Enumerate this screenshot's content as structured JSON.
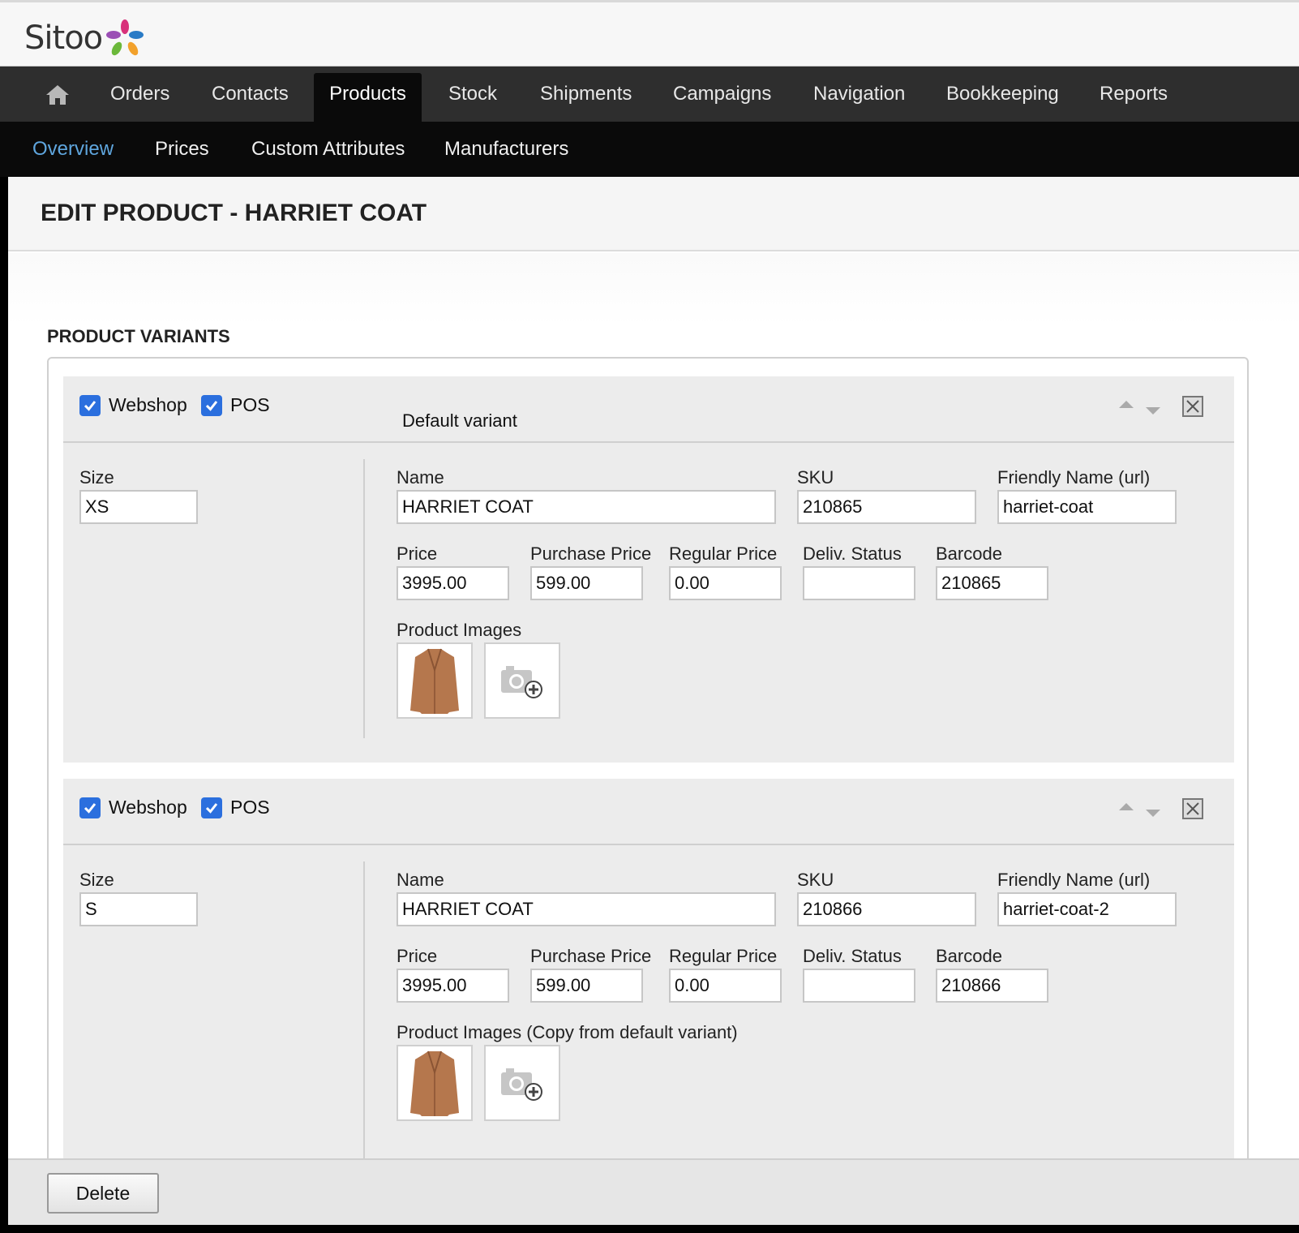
{
  "brand": {
    "logo_text": "Sitoo"
  },
  "main_nav": {
    "items": [
      "Orders",
      "Contacts",
      "Products",
      "Stock",
      "Shipments",
      "Campaigns",
      "Navigation",
      "Bookkeeping",
      "Reports"
    ],
    "active": "Products"
  },
  "sub_nav": {
    "items": [
      "Overview",
      "Prices",
      "Custom Attributes",
      "Manufacturers"
    ],
    "active": "Overview"
  },
  "page": {
    "title": "EDIT PRODUCT - HARRIET COAT",
    "section_title": "PRODUCT VARIANTS"
  },
  "labels": {
    "webshop": "Webshop",
    "pos": "POS",
    "size": "Size",
    "name": "Name",
    "sku": "SKU",
    "friendly": "Friendly Name (url)",
    "price": "Price",
    "purchase_price": "Purchase Price",
    "regular_price": "Regular Price",
    "deliv_status": "Deliv. Status",
    "barcode": "Barcode"
  },
  "variants": [
    {
      "webshop_checked": true,
      "pos_checked": true,
      "default_label": "Default variant",
      "size": "XS",
      "name": "HARRIET COAT",
      "sku": "210865",
      "friendly": "harriet-coat",
      "price": "3995.00",
      "purchase_price": "599.00",
      "regular_price": "0.00",
      "deliv_status": "",
      "barcode": "210865",
      "images_label": "Product Images"
    },
    {
      "webshop_checked": true,
      "pos_checked": true,
      "default_label": "",
      "size": "S",
      "name": "HARRIET COAT",
      "sku": "210866",
      "friendly": "harriet-coat-2",
      "price": "3995.00",
      "purchase_price": "599.00",
      "regular_price": "0.00",
      "deliv_status": "",
      "barcode": "210866",
      "images_label": "Product Images (Copy from default variant)"
    }
  ],
  "footer": {
    "delete_label": "Delete"
  },
  "colors": {
    "active_subnav": "#5fa6de",
    "checkbox": "#2b6fde",
    "coat": "#b5774d"
  }
}
